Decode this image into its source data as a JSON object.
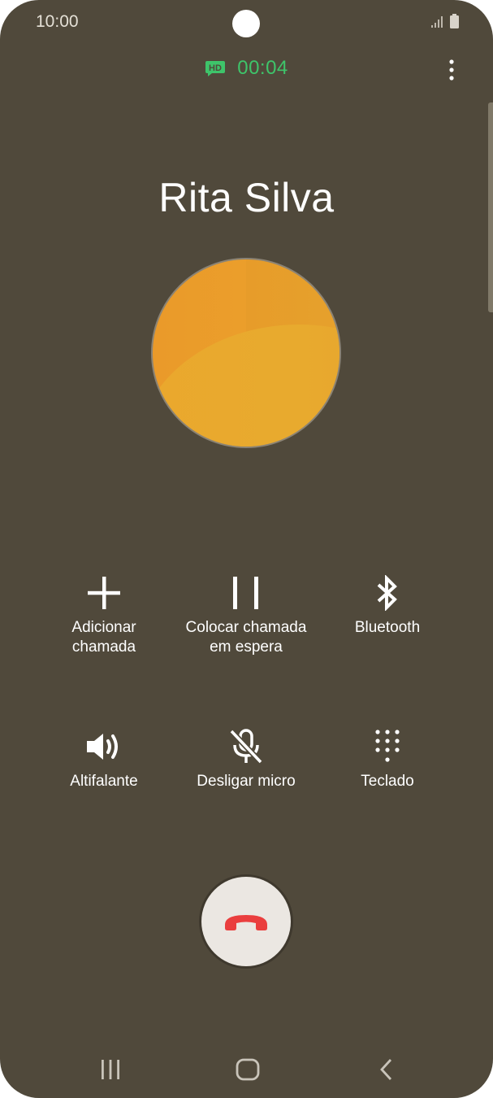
{
  "status_bar": {
    "time": "10:00",
    "icons": [
      "signal-icon",
      "battery-icon"
    ]
  },
  "call": {
    "hd_badge": "HD",
    "timer": "00:04",
    "caller_name": "Rita Silva"
  },
  "actions": [
    {
      "icon": "plus-icon",
      "label": "Adicionar\nchamada"
    },
    {
      "icon": "pause-icon",
      "label": "Colocar chamada\nem espera"
    },
    {
      "icon": "bluetooth-icon",
      "label": "Bluetooth"
    },
    {
      "icon": "speaker-icon",
      "label": "Altifalante"
    },
    {
      "icon": "mic-off-icon",
      "label": "Desligar micro"
    },
    {
      "icon": "keypad-icon",
      "label": "Teclado"
    }
  ],
  "end_call": {
    "icon": "phone-hangup-icon"
  },
  "navigation": [
    "recent-apps-icon",
    "home-icon",
    "back-icon"
  ],
  "colors": {
    "background": "#50493b",
    "timer_green": "#3ec46a",
    "end_call_red": "#ea3e3e",
    "avatar_orange": "#eba02c"
  }
}
